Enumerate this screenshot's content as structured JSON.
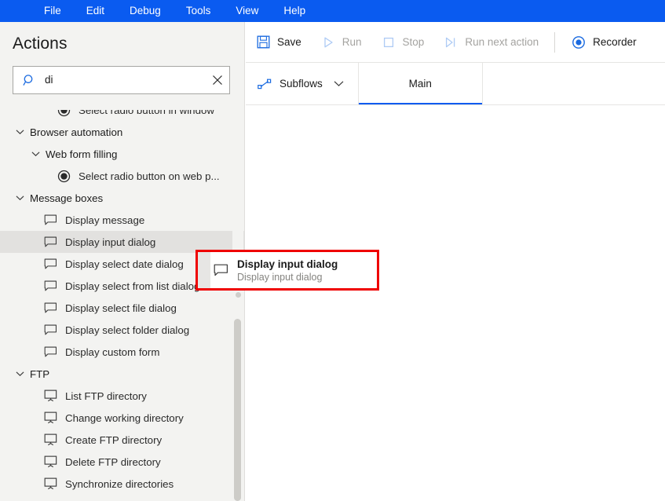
{
  "menubar": {
    "items": [
      {
        "label": "File"
      },
      {
        "label": "Edit"
      },
      {
        "label": "Debug"
      },
      {
        "label": "Tools"
      },
      {
        "label": "View"
      },
      {
        "label": "Help"
      }
    ],
    "background_color": "#0a5bf0"
  },
  "sidebar": {
    "title": "Actions",
    "search": {
      "value": "di",
      "placeholder": "Search actions",
      "search_icon": "search-icon",
      "clear_icon": "close-icon"
    },
    "tree": [
      {
        "label": "Select radio button in window",
        "type": "action",
        "icon": "radio-button-icon",
        "indent": 3,
        "clipped": true
      },
      {
        "label": "Browser automation",
        "type": "group",
        "icon": "chevron-down-icon",
        "indent": 1,
        "expanded": true
      },
      {
        "label": "Web form filling",
        "type": "group",
        "icon": "chevron-down-icon",
        "indent": 2,
        "expanded": true
      },
      {
        "label": "Select radio button on web p...",
        "type": "action",
        "icon": "radio-button-icon",
        "indent": 3
      },
      {
        "label": "Message boxes",
        "type": "group",
        "icon": "chevron-down-icon",
        "indent": 1,
        "expanded": true
      },
      {
        "label": "Display message",
        "type": "action",
        "icon": "message-box-icon",
        "indent": 2
      },
      {
        "label": "Display input dialog",
        "type": "action",
        "icon": "message-box-icon",
        "indent": 2,
        "selected": true
      },
      {
        "label": "Display select date dialog",
        "type": "action",
        "icon": "message-box-icon",
        "indent": 2
      },
      {
        "label": "Display select from list dialog",
        "type": "action",
        "icon": "message-box-icon",
        "indent": 2
      },
      {
        "label": "Display select file dialog",
        "type": "action",
        "icon": "message-box-icon",
        "indent": 2
      },
      {
        "label": "Display select folder dialog",
        "type": "action",
        "icon": "message-box-icon",
        "indent": 2
      },
      {
        "label": "Display custom form",
        "type": "action",
        "icon": "message-box-icon",
        "indent": 2
      },
      {
        "label": "FTP",
        "type": "group",
        "icon": "chevron-down-icon",
        "indent": 1,
        "expanded": true
      },
      {
        "label": "List FTP directory",
        "type": "action",
        "icon": "monitor-icon",
        "indent": 2
      },
      {
        "label": "Change working directory",
        "type": "action",
        "icon": "monitor-icon",
        "indent": 2
      },
      {
        "label": "Create FTP directory",
        "type": "action",
        "icon": "monitor-icon",
        "indent": 2
      },
      {
        "label": "Delete FTP directory",
        "type": "action",
        "icon": "monitor-icon",
        "indent": 2
      },
      {
        "label": "Synchronize directories",
        "type": "action",
        "icon": "monitor-icon",
        "indent": 2
      }
    ]
  },
  "toolbar": {
    "save_label": "Save",
    "run_label": "Run",
    "stop_label": "Stop",
    "run_next_label": "Run next action",
    "recorder_label": "Recorder",
    "save_enabled": true,
    "run_enabled": false,
    "stop_enabled": false,
    "run_next_enabled": false,
    "accent_color": "#0a5bf0"
  },
  "tabstrip": {
    "subflows_label": "Subflows",
    "tabs": [
      {
        "label": "Main",
        "active": true
      }
    ]
  },
  "drag_item": {
    "title": "Display input dialog",
    "subtitle": "Display input dialog",
    "icon": "message-box-icon",
    "highlight_color": "#ef0000"
  }
}
